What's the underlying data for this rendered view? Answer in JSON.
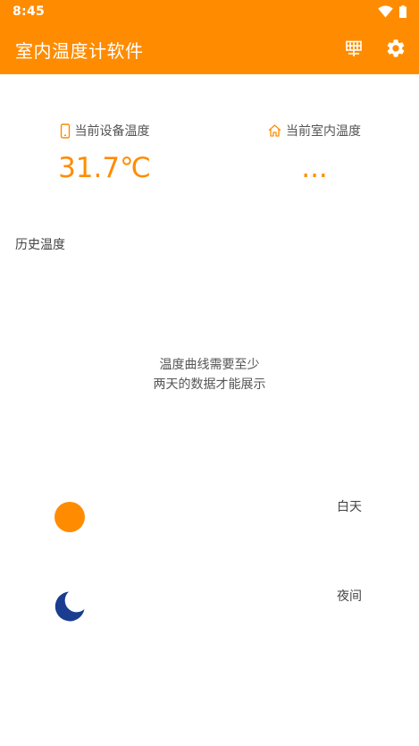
{
  "status_bar": {
    "time": "8:45",
    "icons": [
      "wifi-icon",
      "battery-icon"
    ]
  },
  "app_bar": {
    "title": "室内温度计软件",
    "actions": [
      "calendar-icon",
      "gear-icon"
    ]
  },
  "device_temp": {
    "icon": "phone-icon",
    "label": "当前设备温度",
    "value": "31.7℃"
  },
  "indoor_temp": {
    "icon": "home-icon",
    "label": "当前室内温度",
    "value": "..."
  },
  "history": {
    "title": "历史温度",
    "empty_line1": "温度曲线需要至少",
    "empty_line2": "两天的数据才能展示"
  },
  "legend": {
    "day": {
      "label": "白天",
      "color": "#FF8C00",
      "icon": "sun-icon"
    },
    "night": {
      "label": "夜间",
      "color": "#1A3D8F",
      "icon": "moon-icon"
    }
  },
  "colors": {
    "accent": "#FF8C00",
    "night": "#1A3D8F"
  }
}
